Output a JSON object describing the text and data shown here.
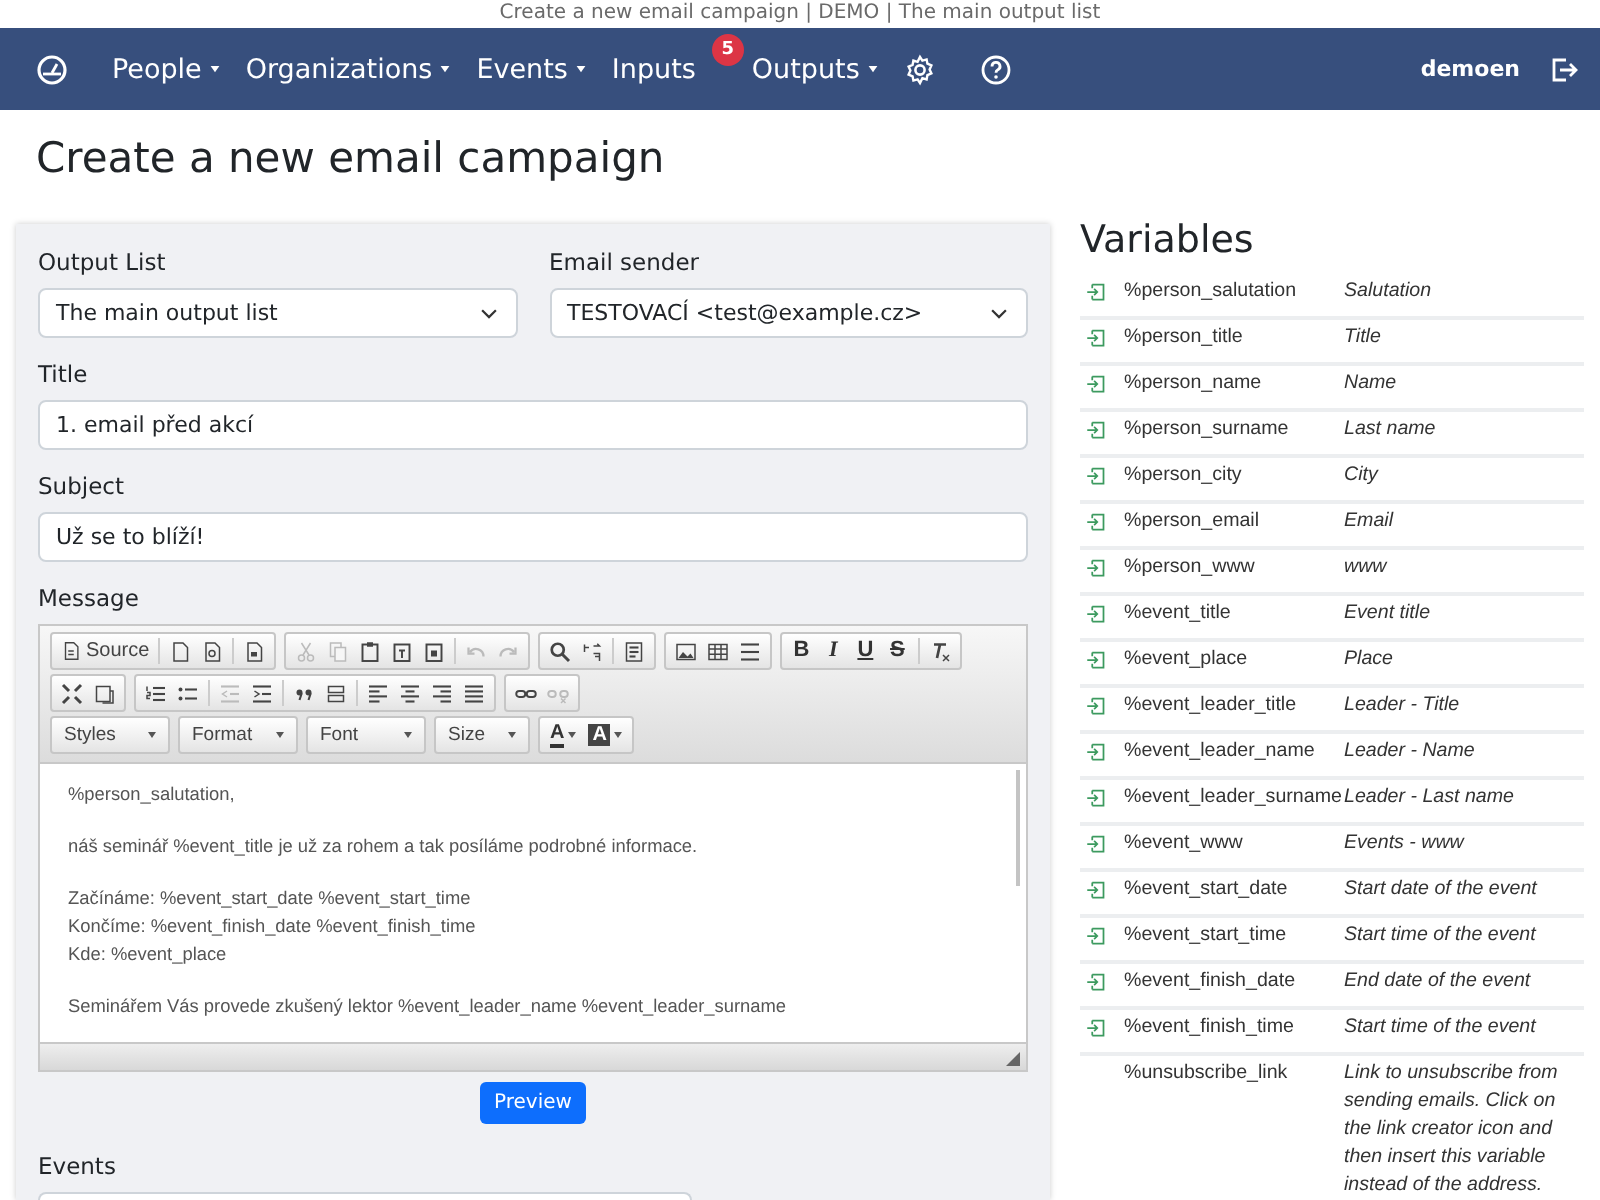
{
  "browser_title": "Create a new email campaign | DEMO | The main output list",
  "nav": {
    "items": [
      {
        "kind": "icon"
      },
      {
        "kind": "menu",
        "label": "People",
        "dropdown": true
      },
      {
        "kind": "menu",
        "label": "Organizations",
        "dropdown": true
      },
      {
        "kind": "menu",
        "label": "Events",
        "dropdown": true
      },
      {
        "kind": "menu",
        "label": "Inputs",
        "dropdown": false,
        "badge": "5"
      },
      {
        "kind": "menu",
        "label": "Outputs",
        "dropdown": true
      },
      {
        "kind": "icon"
      },
      {
        "kind": "icon"
      }
    ],
    "user": "demoen"
  },
  "heading": "Create a new email campaign",
  "form": {
    "output_list": {
      "label": "Output List",
      "value": "The main output list"
    },
    "email_sender": {
      "label": "Email sender",
      "value": "TESTOVACÍ <test@example.cz>"
    },
    "title": {
      "label": "Title",
      "value": "1. email před akcí"
    },
    "subject": {
      "label": "Subject",
      "value": "Už se to blíží!"
    },
    "message": {
      "label": "Message",
      "toolbar": [
        [
          [
            {
              "kind": "text",
              "label": "Source",
              "disabled": false
            },
            {
              "kind": "sep"
            },
            {
              "kind": "icon",
              "disabled": false
            },
            {
              "kind": "icon",
              "disabled": false
            },
            {
              "kind": "sep"
            },
            {
              "kind": "icon",
              "disabled": false
            }
          ],
          [
            {
              "kind": "icon",
              "disabled": true
            },
            {
              "kind": "icon",
              "disabled": true
            },
            {
              "kind": "icon",
              "disabled": false
            },
            {
              "kind": "icon",
              "disabled": false
            },
            {
              "kind": "icon",
              "disabled": false
            },
            {
              "kind": "sep"
            },
            {
              "kind": "icon",
              "disabled": true
            },
            {
              "kind": "icon",
              "disabled": true
            }
          ],
          [
            {
              "kind": "icon",
              "disabled": false
            },
            {
              "kind": "icon",
              "disabled": false
            },
            {
              "kind": "sep"
            },
            {
              "kind": "icon",
              "disabled": false
            }
          ],
          [
            {
              "kind": "icon",
              "disabled": false
            },
            {
              "kind": "icon",
              "disabled": false
            },
            {
              "kind": "icon",
              "disabled": false
            }
          ],
          [
            {
              "kind": "glyph",
              "label": "B",
              "disabled": false
            },
            {
              "kind": "glyph",
              "label": "I",
              "disabled": false
            },
            {
              "kind": "glyph",
              "label": "U",
              "disabled": false
            },
            {
              "kind": "glyph",
              "label": "S",
              "disabled": false
            },
            {
              "kind": "sep"
            },
            {
              "kind": "icon",
              "disabled": false
            }
          ]
        ],
        [
          [
            {
              "kind": "icon",
              "disabled": false
            },
            {
              "kind": "icon",
              "disabled": false
            }
          ],
          [
            {
              "kind": "icon",
              "disabled": false
            },
            {
              "kind": "icon",
              "disabled": false
            },
            {
              "kind": "sep"
            },
            {
              "kind": "icon",
              "disabled": true
            },
            {
              "kind": "icon",
              "disabled": false
            },
            {
              "kind": "sep"
            },
            {
              "kind": "icon",
              "disabled": false
            },
            {
              "kind": "icon",
              "disabled": false
            },
            {
              "kind": "sep"
            },
            {
              "kind": "icon",
              "disabled": false
            },
            {
              "kind": "icon",
              "disabled": false
            },
            {
              "kind": "icon",
              "disabled": false
            },
            {
              "kind": "icon",
              "disabled": false
            }
          ],
          [
            {
              "kind": "icon",
              "disabled": false
            },
            {
              "kind": "icon",
              "disabled": true
            }
          ]
        ],
        [
          [
            {
              "kind": "combo",
              "label": "Styles"
            }
          ],
          [
            {
              "kind": "combo",
              "label": "Format"
            }
          ],
          [
            {
              "kind": "combo",
              "label": "Font"
            }
          ],
          [
            {
              "kind": "combo",
              "label": "Size"
            }
          ],
          [
            {
              "kind": "color",
              "label": "A"
            },
            {
              "kind": "color",
              "label": "A"
            }
          ]
        ]
      ],
      "paragraphs": [
        [
          "%person_salutation,"
        ],
        [
          "náš seminář %event_title je už za rohem a tak posíláme podrobné informace."
        ],
        [
          "Začínáme: %event_start_date %event_start_time",
          "Končíme: %event_finish_date %event_finish_time",
          "Kde: %event_place"
        ],
        [
          "Seminářem Vás provede zkušený lektor %event_leader_name %event_leader_surname"
        ]
      ]
    },
    "preview_button": "Preview",
    "events": {
      "label": "Events"
    }
  },
  "variables": {
    "title": "Variables",
    "rows": [
      {
        "name": "%person_salutation",
        "description": "Salutation",
        "insertable": true
      },
      {
        "name": "%person_title",
        "description": "Title",
        "insertable": true
      },
      {
        "name": "%person_name",
        "description": "Name",
        "insertable": true
      },
      {
        "name": "%person_surname",
        "description": "Last name",
        "insertable": true
      },
      {
        "name": "%person_city",
        "description": "City",
        "insertable": true
      },
      {
        "name": "%person_email",
        "description": "Email",
        "insertable": true
      },
      {
        "name": "%person_www",
        "description": "www",
        "insertable": true
      },
      {
        "name": "%event_title",
        "description": "Event title",
        "insertable": true
      },
      {
        "name": "%event_place",
        "description": "Place",
        "insertable": true
      },
      {
        "name": "%event_leader_title",
        "description": "Leader - Title",
        "insertable": true
      },
      {
        "name": "%event_leader_name",
        "description": "Leader - Name",
        "insertable": true
      },
      {
        "name": "%event_leader_surname",
        "description": "Leader - Last name",
        "insertable": true
      },
      {
        "name": "%event_www",
        "description": "Events - www",
        "insertable": true
      },
      {
        "name": "%event_start_date",
        "description": "Start date of the event",
        "insertable": true
      },
      {
        "name": "%event_start_time",
        "description": "Start time of the event",
        "insertable": true
      },
      {
        "name": "%event_finish_date",
        "description": "End date of the event",
        "insertable": true
      },
      {
        "name": "%event_finish_time",
        "description": "Start time of the event",
        "insertable": true
      },
      {
        "name": "%unsubscribe_link",
        "description": "Link to unsubscribe from sending emails. Click on the link creator icon and then insert this variable instead of the address.",
        "insertable": false
      }
    ]
  }
}
